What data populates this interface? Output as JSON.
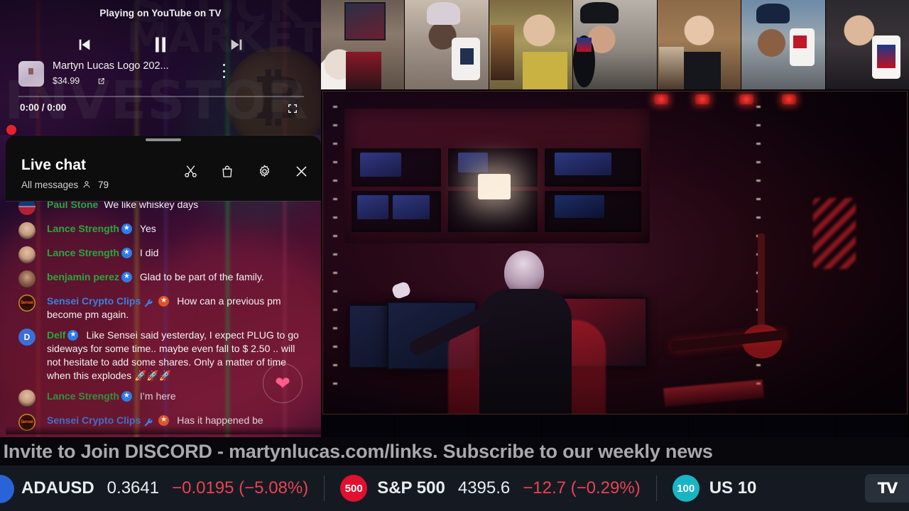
{
  "player": {
    "playing_on": "Playing on YouTube on TV",
    "prev_icon": "previous-track-icon",
    "play_pause_icon": "pause-icon",
    "next_icon": "next-track-icon",
    "product_title": "Martyn Lucas Logo 202...",
    "product_price": "$34.99",
    "external_link_icon": "external-link-icon",
    "more_icon": "kebab-menu-icon",
    "time_display": "0:00 / 0:00",
    "fullscreen_icon": "fullscreen-icon",
    "record_indicator": "live-record-dot"
  },
  "background": {
    "watermark_line1": "STOCK",
    "watermark_line2": "MARKET",
    "watermark_line3": "INVESTOR"
  },
  "chat": {
    "title": "Live chat",
    "filter_label": "All messages",
    "viewer_count": "79",
    "viewer_icon": "person-icon",
    "icons": [
      {
        "name": "scissors-icon",
        "label": "Clip"
      },
      {
        "name": "shopping-bag-icon",
        "label": "Store"
      },
      {
        "name": "gear-icon",
        "label": "Settings"
      },
      {
        "name": "close-icon",
        "label": "Close"
      }
    ],
    "messages": [
      {
        "author": "Paul Stone",
        "author_color": "green",
        "avatar": "flag",
        "avatar_initial": "",
        "badges": [],
        "text": "We like whiskey days",
        "partial_top": true
      },
      {
        "author": "Lance Strength",
        "author_color": "green",
        "avatar": "face",
        "avatar_initial": "",
        "badges": [
          "member-blue-star"
        ],
        "text": "Yes"
      },
      {
        "author": "Lance Strength",
        "author_color": "green",
        "avatar": "face",
        "avatar_initial": "",
        "badges": [
          "member-blue-star"
        ],
        "text": "I did"
      },
      {
        "author": "benjamin perez",
        "author_color": "green",
        "avatar": "face2",
        "avatar_initial": "",
        "badges": [
          "member-blue-star"
        ],
        "text": "Glad to be part of the family."
      },
      {
        "author": "Sensei Crypto Clips",
        "author_color": "blue",
        "avatar": "sensei",
        "avatar_initial": "Sensei",
        "badges": [
          "moderator-wrench",
          "member-orange-star"
        ],
        "text": "How can a previous pm become pm again."
      },
      {
        "author": "Delf",
        "author_color": "green",
        "avatar": "letter",
        "avatar_initial": "D",
        "badges": [
          "member-blue-star"
        ],
        "text": "Like Sensei said yesterday, I expect PLUG to go sideways for some time.. maybe even fall to $ 2.50 .. will not hesitate to add some shares. Only a matter of time when this explodes 🚀🚀🚀"
      },
      {
        "author": "Lance Strength",
        "author_color": "green",
        "avatar": "face",
        "avatar_initial": "",
        "badges": [
          "member-blue-star"
        ],
        "text": "I’m here"
      },
      {
        "author": "Sensei Crypto Clips",
        "author_color": "blue",
        "avatar": "sensei",
        "avatar_initial": "Sensei",
        "badges": [
          "moderator-wrench",
          "member-orange-star"
        ],
        "text": "Has it happened be"
      }
    ],
    "heart_reaction": "❤"
  },
  "banner": {
    "text": ". Invite to Join DISCORD - martynlucas.com/links. Subscribe to our weekly news"
  },
  "ticker": {
    "items": [
      {
        "logo_text": "",
        "logo_color": "#2a63d8",
        "symbol": "ADAUSD",
        "price": "0.3641",
        "change": "−0.0195 (−5.08%)",
        "direction": "down"
      },
      {
        "logo_text": "500",
        "logo_color": "#e01030",
        "symbol": "S&P 500",
        "price": "4395.6",
        "change": "−12.7 (−0.29%)",
        "direction": "down"
      },
      {
        "logo_text": "100",
        "logo_color": "#19b5c4",
        "symbol": "US 10",
        "price": "",
        "change": "",
        "direction": "down"
      }
    ],
    "source_badge": "TradingView"
  },
  "video": {
    "cams": [
      {
        "name": "cam-1",
        "desc": "bearded man with trading poster"
      },
      {
        "name": "cam-2",
        "desc": "woman in headwrap drinking from mug"
      },
      {
        "name": "cam-3",
        "desc": "man in yellow shirt"
      },
      {
        "name": "cam-4",
        "desc": "man in cap with microphone"
      },
      {
        "name": "cam-5",
        "desc": "older man with glasses and mug"
      },
      {
        "name": "cam-6",
        "desc": "man in cap laughing with mug"
      },
      {
        "name": "cam-7",
        "desc": "man with glasses holding union jack mug"
      }
    ],
    "stage_desc": "Dark studio: man seated at multi-monitor desk, red and purple stage lighting"
  }
}
